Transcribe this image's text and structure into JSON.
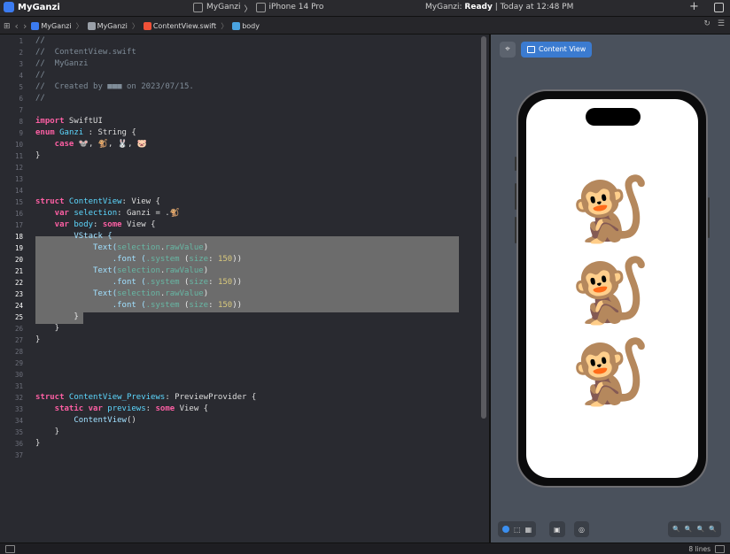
{
  "titlebar": {
    "app_name": "MyGanzi",
    "scheme": "MyGanzi",
    "device": "iPhone 14 Pro",
    "status_prefix": "MyGanzi: ",
    "status_state": "Ready",
    "status_time": " | Today at 12:48 PM",
    "plus": "+"
  },
  "jumpbar": {
    "project": "MyGanzi",
    "folder": "MyGanzi",
    "file": "ContentView.swift",
    "symbol": "body",
    "nav_back": "‹",
    "nav_fwd": "›"
  },
  "editor": {
    "line_numbers": [
      "1",
      "2",
      "3",
      "4",
      "5",
      "6",
      "7",
      "8",
      "9",
      "10",
      "11",
      "12",
      "13",
      "14",
      "15",
      "16",
      "17",
      "18",
      "19",
      "20",
      "21",
      "22",
      "23",
      "24",
      "25",
      "26",
      "27",
      "28",
      "29",
      "30",
      "31",
      "32",
      "33",
      "34",
      "35",
      "36",
      "37"
    ],
    "line1": "//",
    "line2": "//  ContentView.swift",
    "line3": "//  MyGanzi",
    "line4": "//",
    "line5_a": "//  Created by ",
    "line5_name": "■■■",
    "line5_b": " on 2023/07/15.",
    "line6": "//",
    "import_kw": "import",
    "import_mod": " SwiftUI",
    "enum_kw": "enum",
    "enum_name": " Ganzi",
    "enum_rest": " : String {",
    "case_kw": "    case",
    "case_values": " 🐭, 🐒, 🐰, 🐷",
    "close_brace": "}",
    "struct_kw": "struct",
    "struct_name": " ContentView",
    "struct_rest": ": View {",
    "var_kw": "    var",
    "sel_name": " selection",
    "sel_rest": ": Ganzi = .🐒",
    "body_name": " body",
    "body_sep": ": ",
    "some_kw": "some",
    "body_rest": " View {",
    "vstack": "        VStack {",
    "text_call_a": "            Text(",
    "selection": "selection",
    "dot": ".",
    "rawvalue": "rawValue",
    "paren": ")",
    "font_a": "                .font (",
    "system": ".system",
    "size_a": " (",
    "size_kw": "size",
    "size_sep": ": ",
    "size_val": "150",
    "size_end": "))",
    "vstack_close": "        }",
    "inner_close": "    }",
    "prev_struct_name": " ContentView_Previews",
    "prev_rest": ": PreviewProvider {",
    "static_kw": "    static var",
    "previews_name": " previews",
    "previews_rest": " View {",
    "cv_call": "        ContentView",
    "cv_parens": "()"
  },
  "canvas": {
    "pin_icon": "⌖",
    "content_view_label": "Content View",
    "monkeys": [
      "🐒",
      "🐒",
      "🐒"
    ],
    "zoom_icons": [
      "🔍",
      "🔍",
      "🔍",
      "🔍"
    ]
  },
  "statusbar": {
    "lines": "8 lines"
  },
  "colors": {
    "accent": "#3b7bd0",
    "keyword": "#fc5fa3",
    "type": "#5dd8ff",
    "number": "#d9c97c",
    "comment": "#7f8c98"
  }
}
